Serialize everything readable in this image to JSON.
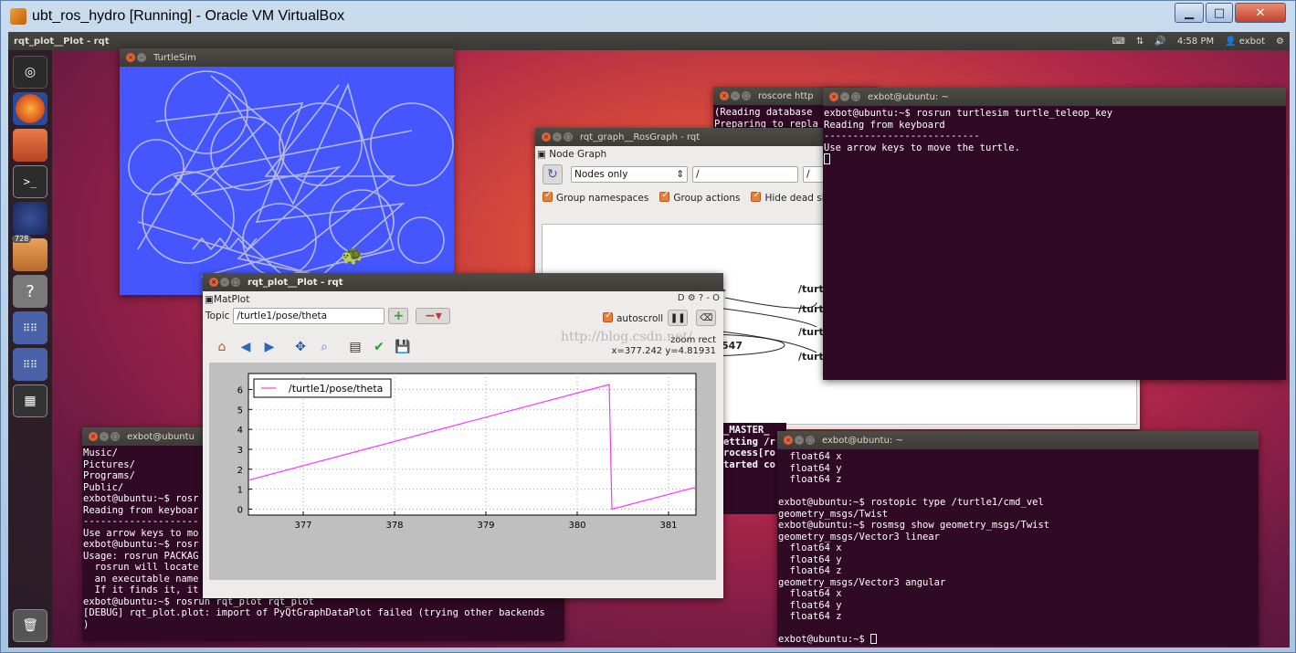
{
  "vbox": {
    "title": "ubt_ros_hydro [Running] - Oracle VM VirtualBox",
    "min": "▁",
    "max": "□",
    "close": "✕"
  },
  "topbar": {
    "app_title": "rqt_plot__Plot - rqt",
    "time": "4:58 PM",
    "user": "exbot",
    "icons": [
      "keyboard-icon",
      "network-icon",
      "volume-icon",
      "gear-icon"
    ]
  },
  "launcher": {
    "badge": "728",
    "icons": [
      "ubuntu-icon",
      "firefox-icon",
      "files-icon",
      "terminal-icon",
      "eclipse-icon",
      "software-icon",
      "help-icon",
      "apps-icon",
      "apps-icon",
      "workspace-icon",
      "trash-icon"
    ]
  },
  "turtlesim": {
    "title": "TurtleSim"
  },
  "roscore": {
    "title": "roscore http",
    "lines": [
      "(Reading database",
      "Preparing to repla"
    ]
  },
  "rosgraph": {
    "title": "rqt_graph__RosGraph - rqt",
    "panel": "Node Graph",
    "mode": "Nodes only",
    "filter1": "/",
    "filter2": "/",
    "check_ns": "Group namespaces",
    "check_actions": "Group actions",
    "check_dead": "Hide dead sinks",
    "nodes": [
      "/turtl",
      "/turtl",
      "/turtl",
      "/turtl",
      "547"
    ],
    "lines_behind": [
      "_MASTER_",
      "etting /r",
      "rocess[ro",
      "tarted co"
    ]
  },
  "teleop": {
    "title": "exbot@ubuntu: ~",
    "lines": [
      "exbot@ubuntu:~$ rosrun turtlesim turtle_teleop_key",
      "Reading from keyboard",
      "---------------------------",
      "Use arrow keys to move the turtle."
    ]
  },
  "term_left": {
    "title": "exbot@ubuntu",
    "lines": [
      "Music/",
      "Pictures/",
      "Programs/",
      "Public/",
      "exbot@ubuntu:~$ rosr",
      "Reading from keyboar",
      "--------------------",
      "Use arrow keys to mo",
      "exbot@ubuntu:~$ rosr",
      "Usage: rosrun PACKAG",
      "  rosrun will locate",
      "  an executable name",
      "  If it finds it, it",
      "exbot@ubuntu:~$ rosrun rqt_plot rqt_plot",
      "[DEBUG] rqt_plot.plot: import of PyQtGraphDataPlot failed (trying other backends",
      ")"
    ]
  },
  "term_right": {
    "title": "exbot@ubuntu: ~",
    "lines": [
      "  float64 x",
      "  float64 y",
      "  float64 z",
      "",
      "exbot@ubuntu:~$ rostopic type /turtle1/cmd_vel",
      "geometry_msgs/Twist",
      "exbot@ubuntu:~$ rosmsg show geometry_msgs/Twist",
      "geometry_msgs/Vector3 linear",
      "  float64 x",
      "  float64 y",
      "  float64 z",
      "geometry_msgs/Vector3 angular",
      "  float64 x",
      "  float64 y",
      "  float64 z",
      "",
      "exbot@ubuntu:~$ "
    ]
  },
  "rqtplot": {
    "title": "rqt_plot__Plot - rqt",
    "panel": "MatPlot",
    "topic_label": "Topic",
    "topic_value": "/turtle1/pose/theta",
    "autoscroll": "autoscroll",
    "mode": "zoom rect",
    "coords": "x=377.242     y=4.81931",
    "watermark": "http://blog.csdn.net/",
    "toolbar_icons": [
      "home-icon",
      "back-icon",
      "forward-icon",
      "pan-icon",
      "zoom-icon",
      "subplots-icon",
      "check-icon",
      "save-icon"
    ]
  },
  "chart_data": {
    "type": "line",
    "title": "",
    "xlabel": "",
    "ylabel": "",
    "xlim": [
      376.4,
      381.3
    ],
    "ylim": [
      -0.3,
      6.8
    ],
    "xticks": [
      377,
      378,
      379,
      380,
      381
    ],
    "yticks": [
      0,
      1,
      2,
      3,
      4,
      5,
      6
    ],
    "grid": true,
    "legend": "top-left",
    "series": [
      {
        "name": "/turtle1/pose/theta",
        "color": "#ff33ff",
        "x": [
          376.4,
          380.35,
          380.38,
          381.3
        ],
        "y": [
          1.45,
          6.25,
          0.0,
          1.1
        ]
      }
    ]
  }
}
